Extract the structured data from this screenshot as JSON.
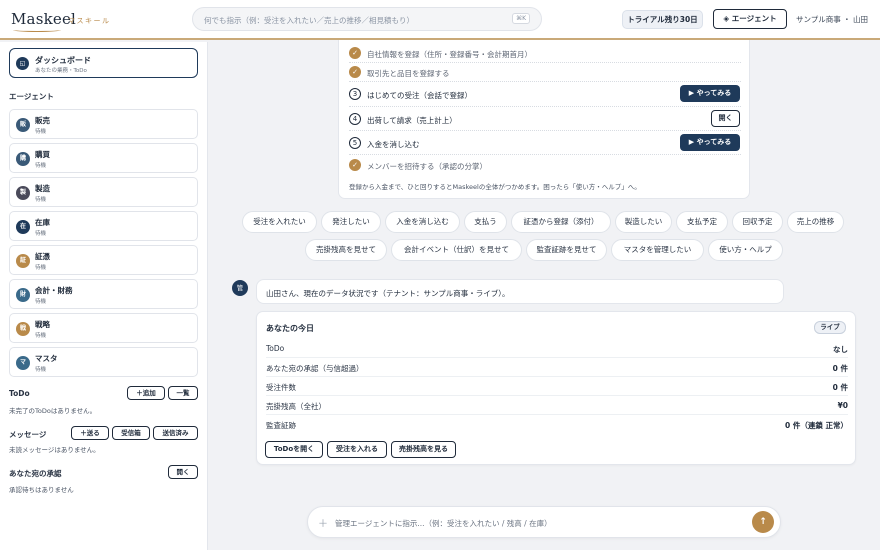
{
  "header": {
    "logo": "Maskeel",
    "logo_sub": "マスキール",
    "search_placeholder": "何でも指示（例：受注を入れたい／売上の推移／相見積もり）",
    "search_shortcut": "⌘K",
    "trial": "トライアル残り30日",
    "agent_button": "◈ エージェント",
    "user": "サンプル商事 ・ 山田"
  },
  "sidebar": {
    "dashboard": {
      "icon": "◱",
      "title": "ダッシュボード",
      "subtitle": "あなたの業務・ToDo"
    },
    "agents_label": "エージェント",
    "agents": [
      {
        "icon": "販",
        "name": "販売",
        "status": "待機",
        "color": "#3a5a78"
      },
      {
        "icon": "購",
        "name": "購買",
        "status": "待機",
        "color": "#3a5a78"
      },
      {
        "icon": "製",
        "name": "製造",
        "status": "待機",
        "color": "#4a4a5a"
      },
      {
        "icon": "在",
        "name": "在庫",
        "status": "待機",
        "color": "#1f3a5a"
      },
      {
        "icon": "証",
        "name": "証憑",
        "status": "待機",
        "color": "#b98a4a"
      },
      {
        "icon": "財",
        "name": "会計・財務",
        "status": "待機",
        "color": "#3a6a8a"
      },
      {
        "icon": "戦",
        "name": "戦略",
        "status": "待機",
        "color": "#b98a4a"
      },
      {
        "icon": "マ",
        "name": "マスタ",
        "status": "待機",
        "color": "#3a6a8a"
      }
    ],
    "todo": {
      "label": "ToDo",
      "add": "＋追加",
      "list": "一覧",
      "empty": "未完了のToDoはありません。"
    },
    "messages": {
      "label": "メッセージ",
      "send": "＋送る",
      "inbox": "受信箱",
      "sent": "送信済み",
      "empty": "未読メッセージはありません。"
    },
    "approvals": {
      "label": "あなた宛の承認",
      "open": "開く",
      "empty": "承認待ちはありません"
    }
  },
  "onboarding": {
    "steps": [
      {
        "marker": "✓",
        "done": true,
        "text": "自社情報を登録（住所・登録番号・会計期首月）"
      },
      {
        "marker": "✓",
        "done": true,
        "text": "取引先と品目を登録する"
      },
      {
        "marker": "3",
        "done": false,
        "text": "はじめての受注（会話で登録）",
        "button": "▶ やってみる"
      },
      {
        "marker": "4",
        "done": false,
        "text": "出荷して請求（売上計上）",
        "button": "開く"
      },
      {
        "marker": "5",
        "done": false,
        "text": "入金を消し込む",
        "button": "▶ やってみる"
      },
      {
        "marker": "✓",
        "done": true,
        "text": "メンバーを招待する（承認の分掌）"
      }
    ],
    "footer": "登録から入金まで、ひと回りするとMaskeelの全体がつかめます。困ったら「使い方・ヘルプ」へ。"
  },
  "chips": [
    "受注を入れたい",
    "発注したい",
    "入金を消し込む",
    "支払う",
    "証憑から登録（添付）",
    "製造したい",
    "支払予定",
    "回収予定",
    "売上の推移",
    "売掛残高を見せて",
    "会計イベント（仕訳）を見せて",
    "監査証跡を見せて",
    "マスタを管理したい",
    "使い方・ヘルプ"
  ],
  "chat": {
    "avatar": "管",
    "message": "山田さん、現在のデータ状況です（テナント：サンプル商事・ライブ）。"
  },
  "today": {
    "title": "あなたの今日",
    "badge": "ライブ",
    "rows": [
      {
        "label": "ToDo",
        "value": "なし"
      },
      {
        "label": "あなた宛の承認（与信超過）",
        "value": "0 件"
      },
      {
        "label": "受注件数",
        "value": "0 件"
      },
      {
        "label": "売掛残高（全社）",
        "value": "¥0"
      },
      {
        "label": "監査証跡",
        "value": "0 件（連鎖 正常）"
      }
    ],
    "buttons": [
      "ToDoを開く",
      "受注を入れる",
      "売掛残高を見る"
    ]
  },
  "composer": {
    "plus": "＋",
    "placeholder": "管理エージェントに指示...（例：受注を入れたい / 残高 / 在庫）",
    "send": "↑"
  }
}
